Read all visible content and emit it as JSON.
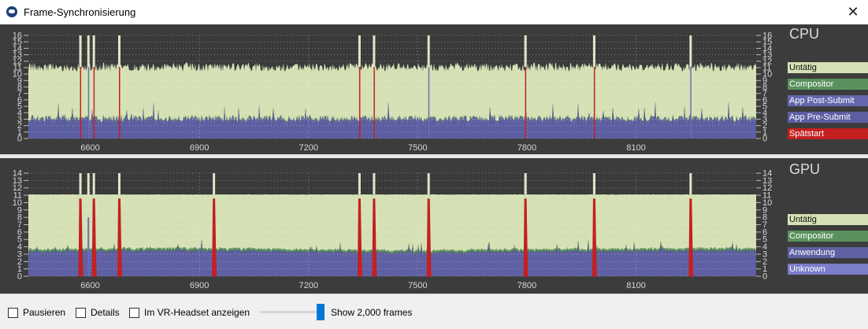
{
  "window": {
    "title": "Frame-Synchronisierung",
    "close_glyph": "✕",
    "icon": "steamvr-icon"
  },
  "cpu": {
    "title": "CPU",
    "legend": [
      {
        "label": "Untätig",
        "color": "#d5e1b5",
        "text_color": "#111111"
      },
      {
        "label": "Compositor",
        "color": "#59915e",
        "text_color": "#ffffff"
      },
      {
        "label": "App Post-Submit",
        "color": "#6467ab",
        "text_color": "#ffffff"
      },
      {
        "label": "App Pre-Submit",
        "color": "#5c5ea2",
        "text_color": "#ffffff"
      },
      {
        "label": "Spätstart",
        "color": "#c42020",
        "text_color": "#ffffff"
      }
    ]
  },
  "gpu": {
    "title": "GPU",
    "legend": [
      {
        "label": "Untätig",
        "color": "#d5e1b5",
        "text_color": "#111111"
      },
      {
        "label": "Compositor",
        "color": "#59915e",
        "text_color": "#ffffff"
      },
      {
        "label": "Anwendung",
        "color": "#5f60a3",
        "text_color": "#ffffff"
      },
      {
        "label": "Unknown",
        "color": "#7a7dc8",
        "text_color": "#ffffff"
      }
    ]
  },
  "controls": {
    "pause_label": "Pausieren",
    "details_label": "Details",
    "headset_label": "Im VR-Headset anzeigen",
    "frames_label": "Show 2,000 frames",
    "slider_value": 1.0
  },
  "chart_data": [
    {
      "type": "area",
      "title": "CPU",
      "x_start": 6430,
      "x_end": 8430,
      "x_ticks": [
        6600,
        6900,
        7200,
        7500,
        7800,
        8100
      ],
      "x_tick_labels": [
        "6600",
        "6900",
        "7200",
        "7500",
        "7800",
        "8100"
      ],
      "ylim": [
        0,
        16
      ],
      "y_ticks": [
        0,
        1,
        2,
        3,
        4,
        5,
        6,
        7,
        8,
        9,
        10,
        11,
        12,
        13,
        14,
        15,
        16
      ],
      "grid": true,
      "frame_budget": 11.1,
      "typical_app_pre_submit": 3.2,
      "typical_app_post_submit": 0.3,
      "typical_compositor": 0.1,
      "spikes": [
        {
          "x": 6573,
          "value": 16,
          "late_start": true
        },
        {
          "x": 6595,
          "value": 16,
          "late_start": false
        },
        {
          "x": 6610,
          "value": 16,
          "late_start": true
        },
        {
          "x": 6680,
          "value": 16,
          "late_start": true
        },
        {
          "x": 7340,
          "value": 16,
          "late_start": true
        },
        {
          "x": 7380,
          "value": 16,
          "late_start": true
        },
        {
          "x": 7530,
          "value": 16,
          "late_start": false
        },
        {
          "x": 7796,
          "value": 16,
          "late_start": true
        },
        {
          "x": 7985,
          "value": 16,
          "late_start": true
        },
        {
          "x": 8250,
          "value": 16,
          "late_start": false
        }
      ],
      "legend_position": "right"
    },
    {
      "type": "area",
      "title": "GPU",
      "x_start": 6430,
      "x_end": 8430,
      "x_ticks": [
        6600,
        6900,
        7200,
        7500,
        7800,
        8100
      ],
      "x_tick_labels": [
        "6600",
        "6900",
        "7200",
        "7500",
        "7800",
        "8100"
      ],
      "ylim": [
        0,
        14
      ],
      "y_ticks": [
        0,
        1,
        2,
        3,
        4,
        5,
        6,
        7,
        8,
        9,
        10,
        11,
        12,
        13,
        14
      ],
      "grid": true,
      "frame_budget": 11.1,
      "typical_anwendung": 3.3,
      "typical_compositor": 0.4,
      "spikes": [
        {
          "x": 6573,
          "value": 14,
          "red_peak": 10.5
        },
        {
          "x": 6595,
          "value": 14,
          "red_peak": 0
        },
        {
          "x": 6610,
          "value": 14,
          "red_peak": 10.5
        },
        {
          "x": 6680,
          "value": 14,
          "red_peak": 10.5
        },
        {
          "x": 6940,
          "value": 14,
          "red_peak": 10.5
        },
        {
          "x": 7340,
          "value": 14,
          "red_peak": 10.5
        },
        {
          "x": 7380,
          "value": 14,
          "red_peak": 10.5
        },
        {
          "x": 7530,
          "value": 14,
          "red_peak": 10.5
        },
        {
          "x": 7796,
          "value": 14,
          "red_peak": 10.5
        },
        {
          "x": 7985,
          "value": 14,
          "red_peak": 10.5
        },
        {
          "x": 8250,
          "value": 14,
          "red_peak": 10.5
        }
      ],
      "legend_position": "right"
    }
  ]
}
